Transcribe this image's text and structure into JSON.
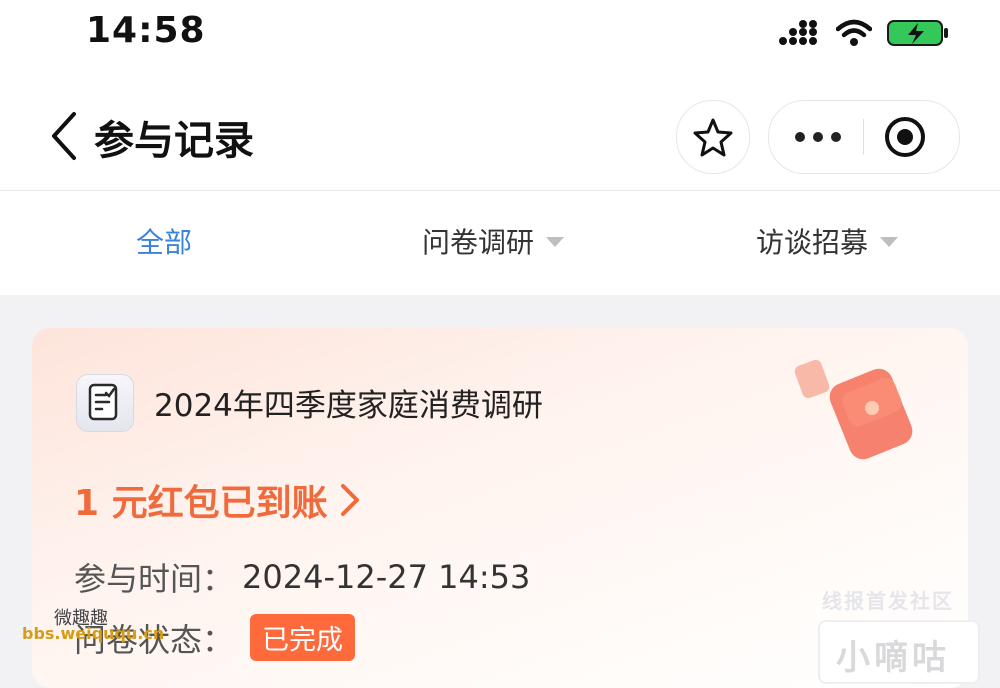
{
  "status_bar": {
    "time": "14:58"
  },
  "nav": {
    "title": "参与记录"
  },
  "tabs": [
    {
      "label": "全部",
      "active": true
    },
    {
      "label": "问卷调研",
      "has_caret": true
    },
    {
      "label": "访谈招募",
      "has_caret": true
    }
  ],
  "card": {
    "title": "2024年四季度家庭消费调研",
    "reward": "1 元红包已到账",
    "time_label": "参与时间：",
    "time_value": "2024-12-27 14:53",
    "status_label": "问卷状态：",
    "status_value": "已完成"
  },
  "watermarks": {
    "right_line": "线报首发社区",
    "right_box": "小嘀咕",
    "left_line1": "微趣趣",
    "left_line2": "bbs.weiququ.cn"
  },
  "colors": {
    "accent_blue": "#3a83d8",
    "reward_orange": "#f06a3b",
    "badge_bg": "#ff6a3d",
    "battery_green": "#34c759"
  },
  "icons": [
    "back-chevron-icon",
    "star-icon",
    "more-dots-icon",
    "target-icon",
    "survey-doc-icon",
    "red-envelope-icon",
    "signal-icon",
    "wifi-icon",
    "battery-charging-icon"
  ]
}
